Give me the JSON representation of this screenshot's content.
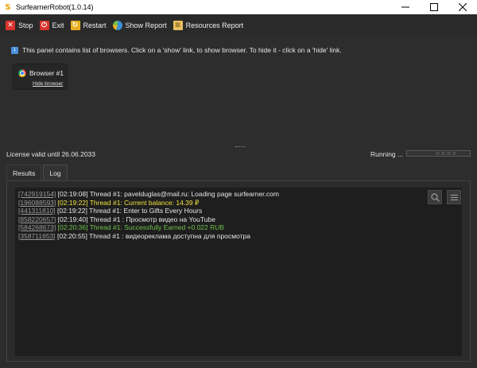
{
  "window": {
    "title": "SurfearnerRobot(1.0.14)"
  },
  "toolbar": {
    "buttons": [
      {
        "label": "Stop",
        "icon": "x-icon",
        "color": "#d9342b"
      },
      {
        "label": "Exit",
        "icon": "power-icon",
        "color": "#d9342b"
      },
      {
        "label": "Restart",
        "icon": "restart-icon",
        "color": "#e8b020"
      },
      {
        "label": "Show Report",
        "icon": "pie-chart-icon",
        "color": "#3b8fd9"
      },
      {
        "label": "Resources Report",
        "icon": "document-icon",
        "color": "#e8c060"
      }
    ]
  },
  "panel": {
    "info": "This panel contains list of browsers. Click on a 'show' link, to show browser. To hide it - click on a 'hide' link.",
    "browsers": [
      {
        "name": "Browser #1",
        "link": "Hide browser"
      }
    ]
  },
  "status": {
    "license": "License valid until 26.06.2033",
    "running": "Running ..."
  },
  "tabs": [
    {
      "label": "Results",
      "active": false
    },
    {
      "label": "Log",
      "active": true
    }
  ],
  "log": [
    {
      "id": "[742919154]",
      "time": "[02:19:08]",
      "text": "Thread #1: pavelduglas@mail.ru: Loading page surfearner.com",
      "color": "white"
    },
    {
      "id": "[196088593]",
      "time": "[02:19:22]",
      "text": "Thread #1: Current balance: 14.39 ₽",
      "color": "yellow"
    },
    {
      "id": "[441311810]",
      "time": "[02:19:22]",
      "text": "Thread #1: Enter to Gifts Every Hours",
      "color": "white"
    },
    {
      "id": "[858220657]",
      "time": "[02:19:40]",
      "text": "Thread #1 : Просмотр видео на YouTube",
      "color": "white"
    },
    {
      "id": "[584268673]",
      "time": "[02:20:36]",
      "text": "Thread #1: Successfully Earned +0.022 RUB",
      "color": "green"
    },
    {
      "id": "[358711653]",
      "time": "[02:20:55]",
      "text": "Thread #1 : видеореклама доступна для просмотра",
      "color": "white"
    }
  ],
  "log_tools": [
    {
      "icon": "search-icon"
    },
    {
      "icon": "menu-icon"
    }
  ]
}
